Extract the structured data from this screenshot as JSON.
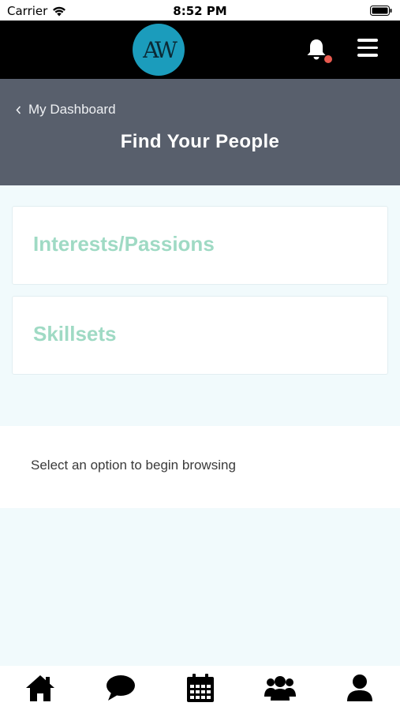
{
  "status_bar": {
    "carrier": "Carrier",
    "time": "8:52 PM"
  },
  "topbar": {
    "logo_text": "AW",
    "icons": [
      "bell-icon",
      "hamburger-menu-icon"
    ],
    "notification_dot_color": "#e85a4f"
  },
  "header": {
    "back_label": "My Dashboard",
    "title": "Find Your People"
  },
  "options": [
    {
      "label": "Interests/Passions"
    },
    {
      "label": "Skillsets"
    }
  ],
  "browse_hint": "Select an option to begin browsing",
  "tabbar": {
    "tabs": [
      "home-icon",
      "chat-icon",
      "calendar-icon",
      "people-icon",
      "profile-icon"
    ]
  },
  "colors": {
    "accent_text": "#9fdac4",
    "header_bg": "#585f6c",
    "logo_bg": "#1b9cbc"
  }
}
